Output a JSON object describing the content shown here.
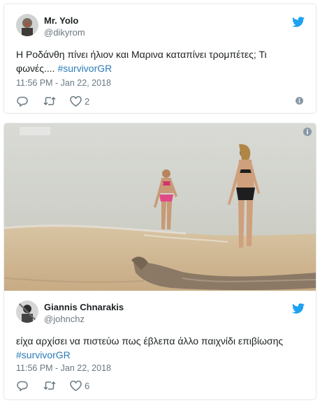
{
  "tweets": [
    {
      "author_name": "Mr. Yolo",
      "author_handle": "@dikyrom",
      "text": "Η Ροδάνθη πίνει ήλιον και Μαρινα καταπίνει τρομπέτες;  Τι",
      "text_line2": "φωνές....",
      "hashtag": "#survivorGR",
      "timestamp": "11:56 PM - Jan 22, 2018",
      "like_count": "2"
    },
    {
      "author_name": "Giannis Chnarakis",
      "author_handle": "@johnchz",
      "text": "είχα αρχίσει να πιστεύω πως έβλεπα άλλο παιχνίδι επιβίωσης",
      "hashtag": "#survivorGR",
      "timestamp": "11:56 PM - Jan 22, 2018",
      "like_count": "6"
    }
  ],
  "icons": [
    "twitter-bird-icon",
    "reply-icon",
    "retweet-icon",
    "heart-icon",
    "info-icon"
  ],
  "colors": {
    "twitter_blue": "#1da1f2",
    "hashtag": "#2b7bb9",
    "meta_gray": "#697882",
    "border": "#e1e8ed"
  }
}
